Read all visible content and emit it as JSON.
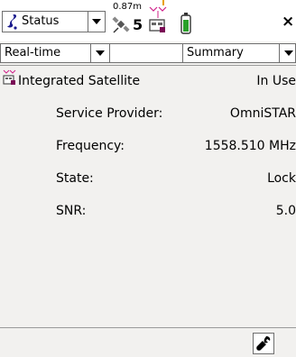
{
  "topbar": {
    "status_label": "Status",
    "accuracy": "0.87m",
    "satellite_count": "5",
    "close_label": "×"
  },
  "toolbar": {
    "mode_select": "Real-time",
    "view_select": "Summary"
  },
  "section": {
    "title": "Integrated Satellite",
    "title_value": "In Use",
    "rows": [
      {
        "label": "Service Provider:",
        "value": "OmniSTAR"
      },
      {
        "label": "Frequency:",
        "value": "1558.510 MHz"
      },
      {
        "label": "State:",
        "value": "Lock"
      },
      {
        "label": "SNR:",
        "value": "5.0"
      }
    ]
  },
  "colors": {
    "background": "#f2f1ef",
    "status_icon": "#1a1a8c",
    "radio_icon_accent": "#d0208a",
    "battery_fill": "#2aa02a"
  },
  "icons": {
    "status": "status-icon",
    "satellite": "satellite-icon",
    "radio": "radio-icon",
    "battery": "battery-icon",
    "wrench": "wrench-icon",
    "header": "integrated-satellite-icon"
  }
}
